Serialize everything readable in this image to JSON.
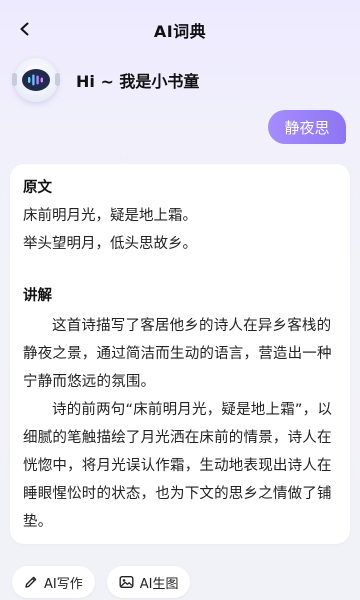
{
  "header": {
    "title": "AI词典",
    "back_icon": "chevron-left-icon"
  },
  "bot": {
    "avatar_icon": "robot-assistant-icon",
    "greeting": "Hi ~ 我是小书童"
  },
  "user_message": "静夜思",
  "answer": {
    "original_title": "原文",
    "poem_lines": [
      "床前明月光，疑是地上霜。",
      "举头望明月，低头思故乡。"
    ],
    "explain_title": "讲解",
    "paragraphs": [
      "这首诗描写了客居他乡的诗人在异乡客栈的静夜之景，通过简洁而生动的语言，营造出一种宁静而悠远的氛围。",
      "诗的前两句“床前明月光，疑是地上霜”，以细腻的笔触描绘了月光洒在床前的情景，诗人在恍惚中，将月光误认作霜，生动地表现出诗人在睡眼惺忪时的状态，也为下文的思乡之情做了铺垫。"
    ]
  },
  "actions": [
    {
      "label": "AI写作",
      "icon": "pen-write-icon"
    },
    {
      "label": "AI生图",
      "icon": "image-generate-icon"
    }
  ],
  "colors": {
    "accent": "#9a82fb",
    "background_top": "#edeaff",
    "card": "#ffffff"
  }
}
